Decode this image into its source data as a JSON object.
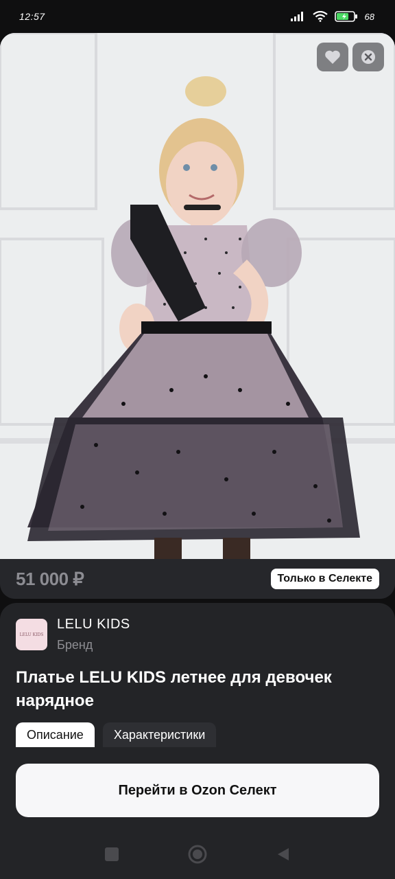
{
  "status_bar": {
    "time": "12:57",
    "battery": "68"
  },
  "product": {
    "price": "51 000 ₽",
    "badge": "Только в Селекте",
    "title": "Платье LELU KIDS летнее для девочек нарядное"
  },
  "brand": {
    "name": "LELU KIDS",
    "subtitle": "Бренд",
    "logo_text": "LELU KIDS"
  },
  "tabs": [
    {
      "label": "Описание",
      "active": true
    },
    {
      "label": "Характеристики",
      "active": false
    }
  ],
  "cta": {
    "label": "Перейти в Ozon Селект"
  },
  "colors": {
    "background": "#0f0f10",
    "card": "#26272b",
    "sheet": "#232427",
    "cta_bg": "#f7f7f9",
    "logo_bg": "#f4dde3"
  },
  "icons": [
    "signal-icon",
    "wifi-icon",
    "battery-icon",
    "heart-icon",
    "close-icon",
    "nav-square-icon",
    "nav-home-icon",
    "nav-back-icon"
  ]
}
